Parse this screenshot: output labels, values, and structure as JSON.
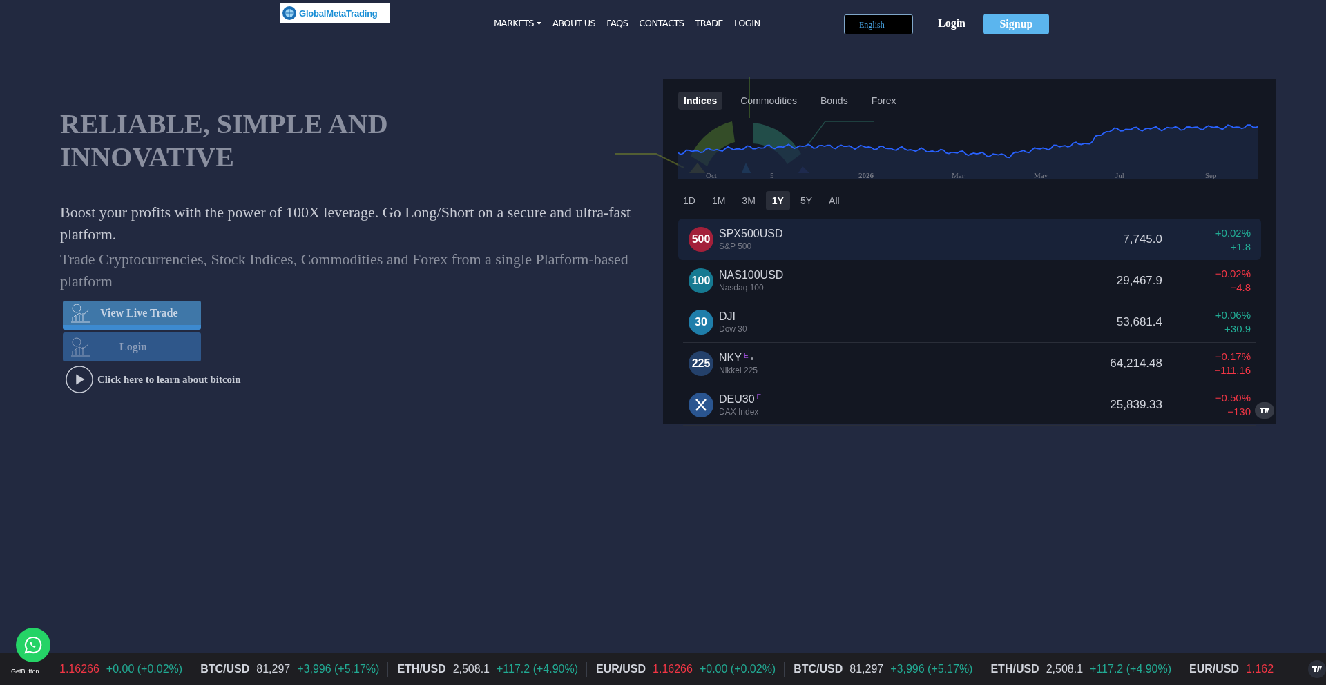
{
  "header": {
    "logo": "GlobalMetaTrading",
    "nav": [
      {
        "label": "MARKETS",
        "dropdown": true
      },
      {
        "label": "ABOUT US",
        "dropdown": false
      },
      {
        "label": "FAQS",
        "dropdown": false
      },
      {
        "label": "CONTACTS",
        "dropdown": false
      },
      {
        "label": "TRADE",
        "dropdown": false
      },
      {
        "label": "LOGIN",
        "dropdown": false
      }
    ],
    "language": "English",
    "login": "Login",
    "signup": "Signup"
  },
  "hero": {
    "title": "RELIABLE, SIMPLE AND INNOVATIVE",
    "subtitle": "Boost your profits with the power of 100X leverage. Go Long/Short on a secure and ultra-fast platform.",
    "subtitle_behind": "Trade Cryptocurrencies, Stock Indices, Commodities and Forex from a single Platform-based platform",
    "buttons": [
      {
        "label": "View Live Trade",
        "kind": "front"
      },
      {
        "label": "Login",
        "kind": "behind"
      }
    ],
    "video_link": "Click here to learn about bitcoin"
  },
  "widget": {
    "tabs": [
      {
        "label": "Indices",
        "selected": true
      },
      {
        "label": "Commodities",
        "selected": false
      },
      {
        "label": "Bonds",
        "selected": false
      },
      {
        "label": "Forex",
        "selected": false
      }
    ],
    "x_labels": [
      "Oct",
      "5",
      "2026",
      "Mar",
      "May",
      "Jul",
      "Sep"
    ],
    "ranges": [
      {
        "label": "1D",
        "selected": false
      },
      {
        "label": "1M",
        "selected": false
      },
      {
        "label": "3M",
        "selected": false
      },
      {
        "label": "1Y",
        "selected": true
      },
      {
        "label": "5Y",
        "selected": false
      },
      {
        "label": "All",
        "selected": false
      }
    ],
    "rows": [
      {
        "badge": "500",
        "kind": "text",
        "color": "#a3203a",
        "symbol": "SPX500USD",
        "flag": "",
        "dot": false,
        "name": "S&P 500",
        "price": "7,745.0",
        "change_pct": "+0.02%",
        "change": "+1.8",
        "positive": true,
        "selected": true
      },
      {
        "badge": "100",
        "kind": "text",
        "color": "#167a92",
        "symbol": "NAS100USD",
        "flag": "",
        "dot": false,
        "name": "Nasdaq 100",
        "price": "29,467.9",
        "change_pct": "−0.02%",
        "change": "−4.8",
        "positive": false,
        "selected": false
      },
      {
        "badge": "30",
        "kind": "text",
        "color": "#1f7eaa",
        "symbol": "DJI",
        "flag": "",
        "dot": false,
        "name": "Dow 30",
        "price": "53,681.4",
        "change_pct": "+0.06%",
        "change": "+30.9",
        "positive": true,
        "selected": false
      },
      {
        "badge": "225",
        "kind": "text",
        "color": "#24416b",
        "symbol": "NKY",
        "flag": "E",
        "dot": true,
        "name": "Nikkei 225",
        "price": "64,214.48",
        "change_pct": "−0.17%",
        "change": "−111.16",
        "positive": false,
        "selected": false
      },
      {
        "badge": "",
        "kind": "glyph",
        "color": "#2a5590",
        "symbol": "DEU30",
        "flag": "E",
        "dot": false,
        "name": "DAX Index",
        "price": "25,839.33",
        "change_pct": "−0.50%",
        "change": "−130",
        "positive": false,
        "selected": false
      }
    ]
  },
  "ticker": [
    {
      "price": "1.16266",
      "price_down": true,
      "change": "+0.00 (+0.02%)",
      "change_positive": true
    },
    {
      "symbol": "BTC/USD",
      "price": "81,297",
      "price_down": false,
      "change": "+3,996 (+5.17%)",
      "change_positive": true
    },
    {
      "symbol": "ETH/USD",
      "price": "2,508.1",
      "price_down": false,
      "change": "+117.2 (+4.90%)",
      "change_positive": true
    },
    {
      "symbol": "EUR/USD",
      "price": "1.16266",
      "price_down": true,
      "change": "+0.00 (+0.02%)",
      "change_positive": true
    },
    {
      "symbol": "BTC/USD",
      "price": "81,297",
      "price_down": false,
      "change": "+3,996 (+5.17%)",
      "change_positive": true
    },
    {
      "symbol": "ETH/USD",
      "price": "2,508.1",
      "price_down": false,
      "change": "+117.2 (+4.90%)",
      "change_positive": true
    },
    {
      "symbol": "EUR/USD",
      "price": "1.162",
      "price_down": true
    }
  ],
  "chat_widget": {
    "caption": "GetButton"
  }
}
